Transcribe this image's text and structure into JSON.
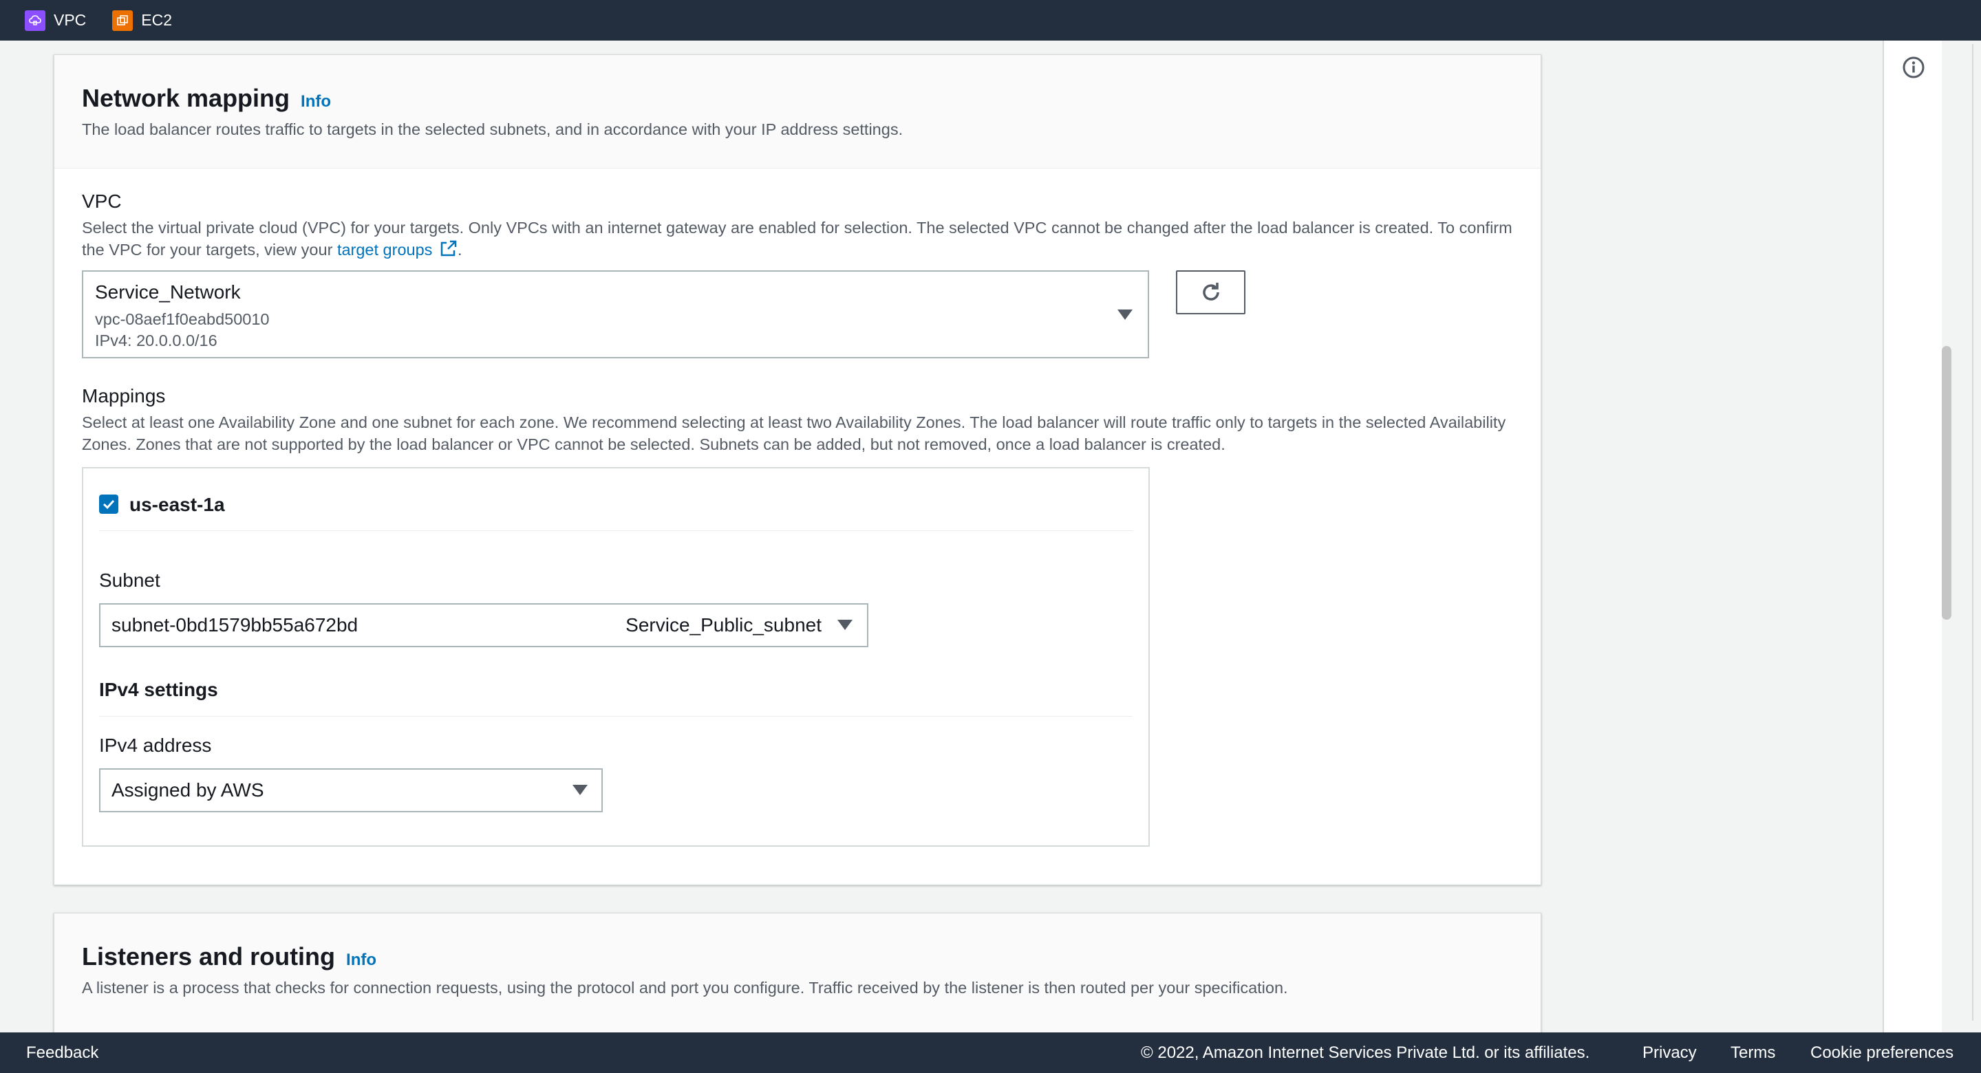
{
  "topbar": {
    "services": [
      {
        "label": "VPC",
        "icon": "vpc-icon",
        "color": "#8c4fff"
      },
      {
        "label": "EC2",
        "icon": "ec2-icon",
        "color": "#ed7100"
      }
    ]
  },
  "network_mapping": {
    "title": "Network mapping",
    "info": "Info",
    "description": "The load balancer routes traffic to targets in the selected subnets, and in accordance with your IP address settings.",
    "vpc": {
      "label": "VPC",
      "description_before_link": "Select the virtual private cloud (VPC) for your targets. Only VPCs with an internet gateway are enabled for selection. The selected VPC cannot be changed after the load balancer is created. To confirm the VPC for your targets, view your ",
      "link_text": "target groups",
      "description_after_link": ".",
      "selected_name": "Service_Network",
      "selected_id": "vpc-08aef1f0eabd50010",
      "selected_cidr": "IPv4: 20.0.0.0/16"
    },
    "mappings": {
      "label": "Mappings",
      "description": "Select at least one Availability Zone and one subnet for each zone. We recommend selecting at least two Availability Zones. The load balancer will route traffic only to targets in the selected Availability Zones. Zones that are not supported by the load balancer or VPC cannot be selected. Subnets can be added, but not removed, once a load balancer is created.",
      "zone": {
        "name": "us-east-1a",
        "checked": true,
        "subnet_label": "Subnet",
        "subnet_id": "subnet-0bd1579bb55a672bd",
        "subnet_name": "Service_Public_subnet",
        "ipv4_settings_label": "IPv4 settings",
        "ipv4_address_label": "IPv4 address",
        "ipv4_address_value": "Assigned by AWS"
      }
    }
  },
  "listeners": {
    "title": "Listeners and routing",
    "info": "Info",
    "description": "A listener is a process that checks for connection requests, using the protocol and port you configure. Traffic received by the listener is then routed per your specification."
  },
  "footer": {
    "feedback": "Feedback",
    "copyright": "© 2022, Amazon Internet Services Private Ltd. or its affiliates.",
    "links": [
      "Privacy",
      "Terms",
      "Cookie preferences"
    ]
  },
  "colors": {
    "nav_bg": "#232f3e",
    "link": "#0073bb",
    "page_bg": "#f2f3f3"
  }
}
